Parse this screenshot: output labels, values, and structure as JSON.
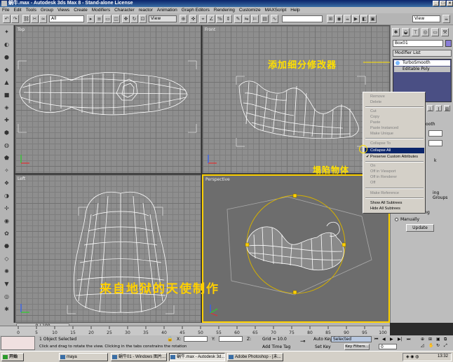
{
  "window": {
    "title": "蜗牛.max - Autodesk 3ds Max 8 - Stand-alone License",
    "min": "_",
    "max": "□",
    "close": "×"
  },
  "menu": [
    "File",
    "Edit",
    "Tools",
    "Group",
    "Views",
    "Create",
    "Modifiers",
    "Character",
    "reactor",
    "Animation",
    "Graph Editors",
    "Rendering",
    "Customize",
    "MAXScript",
    "Help"
  ],
  "toolbar": {
    "selection_filter": "All",
    "ref_coord": "View",
    "named_sel": "",
    "view2": "View"
  },
  "viewports": {
    "top": {
      "label": "Top"
    },
    "front": {
      "label": "Front"
    },
    "left": {
      "label": "Left"
    },
    "perspective": {
      "label": "Perspective"
    }
  },
  "command_panel": {
    "object_name": "Box01",
    "modifier_list": "Modifier List",
    "stack": [
      "TurboSmooth",
      "Editable Poly"
    ],
    "partial": {
      "p1": "ooth",
      "p2": "k",
      "p3": "ing Groups"
    },
    "update_group": {
      "header": "When Rendering",
      "manually": "Manually",
      "update": "Update"
    }
  },
  "context_menu": {
    "items": [
      "Remove",
      "Delete",
      "Cut",
      "Copy",
      "Paste",
      "Paste Instanced",
      "Make Unique",
      "Collapse To",
      "Collapse All",
      "Preserve Custom Attributes",
      "On",
      "Off in Viewport",
      "Off in Renderer",
      "Off",
      "Make Reference",
      "Show All Subtrees",
      "Hide All Subtrees"
    ],
    "highlighted": "Collapse All",
    "checked": "Preserve Custom Attributes"
  },
  "annotations": {
    "add_modifier": "添加细分修改器",
    "collapse": "塌陷物体",
    "watermark": "来自地狱的天使制作"
  },
  "timeline": {
    "frame": "0 / 100",
    "ticks": [
      "0",
      "5",
      "10",
      "15",
      "20",
      "25",
      "30",
      "35",
      "40",
      "45",
      "50",
      "55",
      "60",
      "65",
      "70",
      "75",
      "80",
      "85",
      "90",
      "95",
      "100"
    ]
  },
  "status": {
    "selected": "1 Object Selected",
    "prompt": "Click and drag to rotate the view. Clicking in the tabs constrains the rotation",
    "x_label": "X:",
    "y_label": "Y:",
    "z_label": "Z:",
    "grid": "Grid = 10.0",
    "add_time_tag": "Add Time Tag",
    "auto_key": "Auto Key",
    "auto_key_mode": "Selected",
    "set_key": "Set Key",
    "key_filters": "Key Filters...",
    "frame_value": "0"
  },
  "taskbar": {
    "start": "开始",
    "tasks": [
      "maya",
      "蜗牛01 - Windows 图片...",
      "蜗牛.max - Autodesk 3d...",
      "Adobe Photoshop - [未..."
    ],
    "clock": "13:32"
  },
  "colors": {
    "annotation": "#ffe000",
    "highlight": "#0a246a",
    "viewport_bg": "#8e8e8e",
    "active_border": "#ffd200"
  }
}
